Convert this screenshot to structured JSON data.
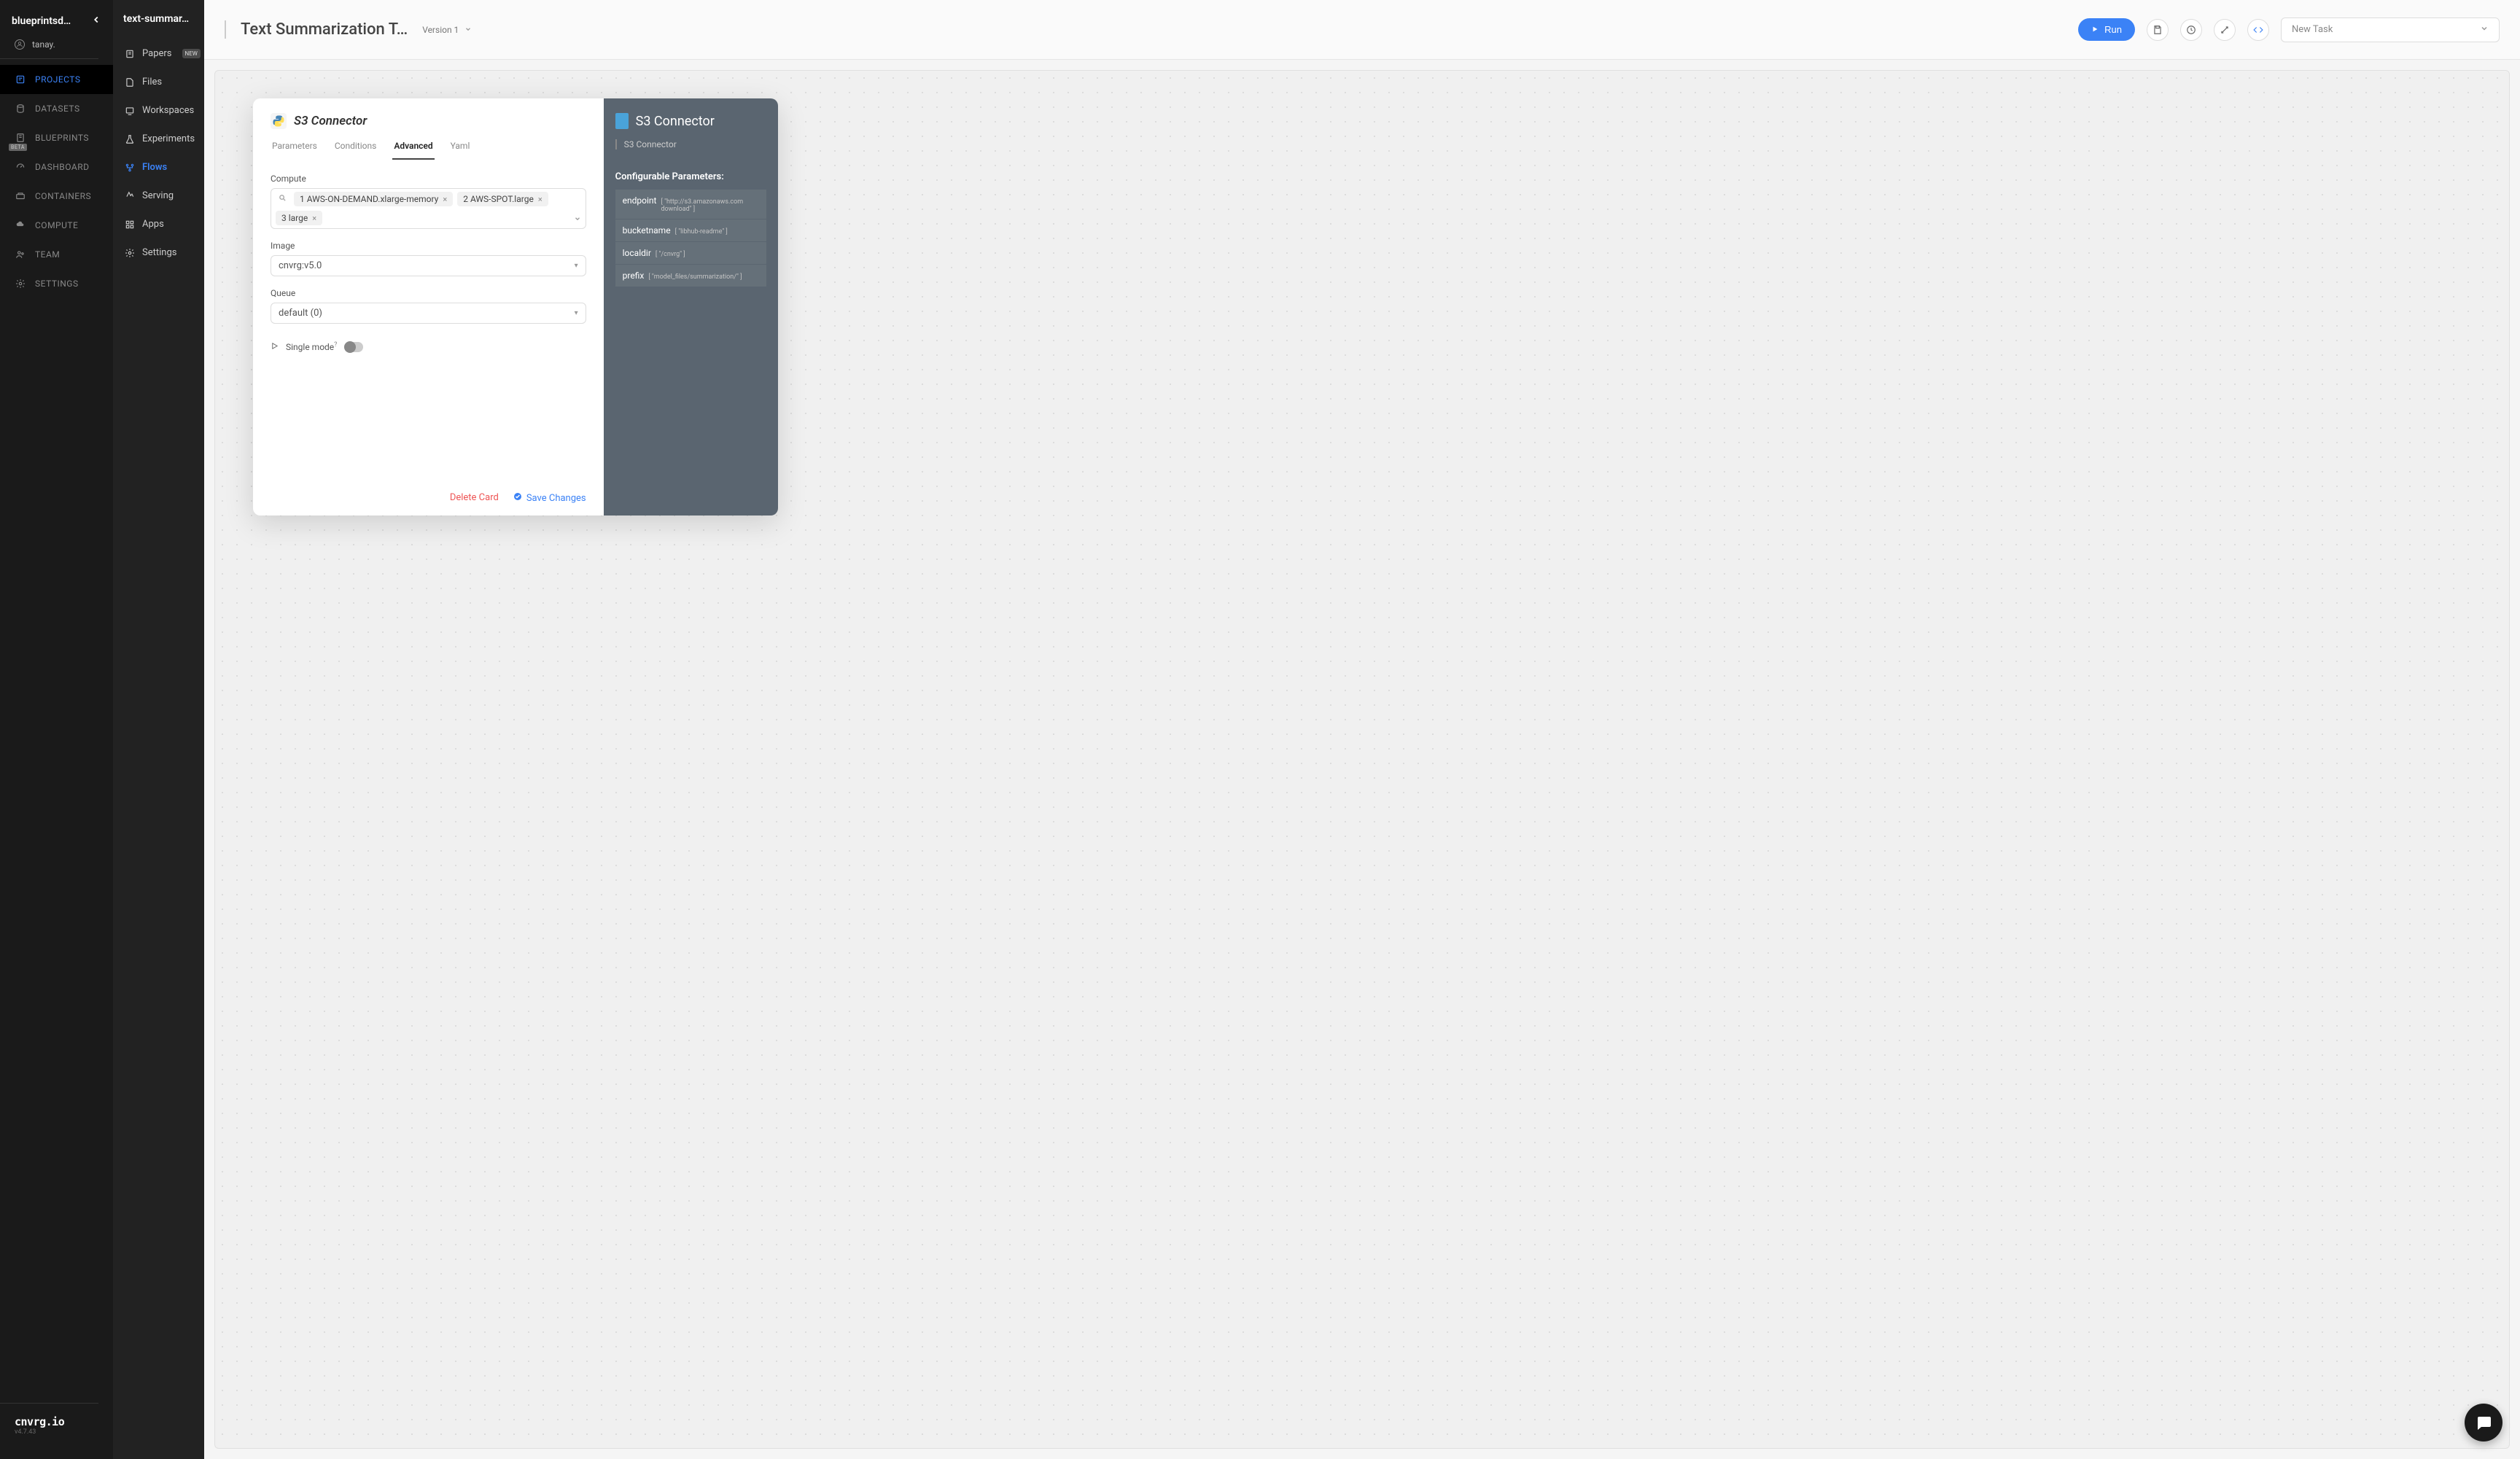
{
  "org": "blueprintsd…",
  "user": "tanay.",
  "nav_primary": [
    {
      "label": "PROJECTS"
    },
    {
      "label": "DATASETS"
    },
    {
      "label": "BLUEPRINTS",
      "beta": "BETA"
    },
    {
      "label": "DASHBOARD"
    },
    {
      "label": "CONTAINERS"
    },
    {
      "label": "COMPUTE"
    },
    {
      "label": "TEAM"
    },
    {
      "label": "SETTINGS"
    }
  ],
  "brand": {
    "name": "cnvrg.io",
    "version": "v4.7.43"
  },
  "project_name": "text-summar…",
  "nav_secondary": [
    {
      "label": "Papers",
      "badge": "NEW"
    },
    {
      "label": "Files"
    },
    {
      "label": "Workspaces"
    },
    {
      "label": "Experiments"
    },
    {
      "label": "Flows"
    },
    {
      "label": "Serving"
    },
    {
      "label": "Apps"
    },
    {
      "label": "Settings"
    }
  ],
  "page_title": "Text Summarization T…",
  "version_label": "Version 1",
  "run_label": "Run",
  "newtask_placeholder": "New Task",
  "modal": {
    "left_title": "S3 Connector",
    "tabs": [
      "Parameters",
      "Conditions",
      "Advanced",
      "Yaml"
    ],
    "compute_label": "Compute",
    "compute_chips": [
      "1 AWS-ON-DEMAND.xlarge-memory",
      "2 AWS-SPOT.large",
      "3 large"
    ],
    "image_label": "Image",
    "image_value": "cnvrg:v5.0",
    "queue_label": "Queue",
    "queue_value": "default (0)",
    "single_mode_label": "Single mode",
    "delete_label": "Delete Card",
    "save_label": "Save Changes",
    "right_title": "S3 Connector",
    "right_subtitle": "S3 Connector",
    "config_header": "Configurable Parameters:",
    "params": [
      {
        "key": "endpoint",
        "val": "[ \"http://s3.amazonaws.com download\" ]"
      },
      {
        "key": "bucketname",
        "val": "[ \"libhub-readme\" ]"
      },
      {
        "key": "localdir",
        "val": "[ \"/cnvrg\" ]"
      },
      {
        "key": "prefix",
        "val": "[ \"model_files/summarization/\" ]"
      }
    ]
  }
}
